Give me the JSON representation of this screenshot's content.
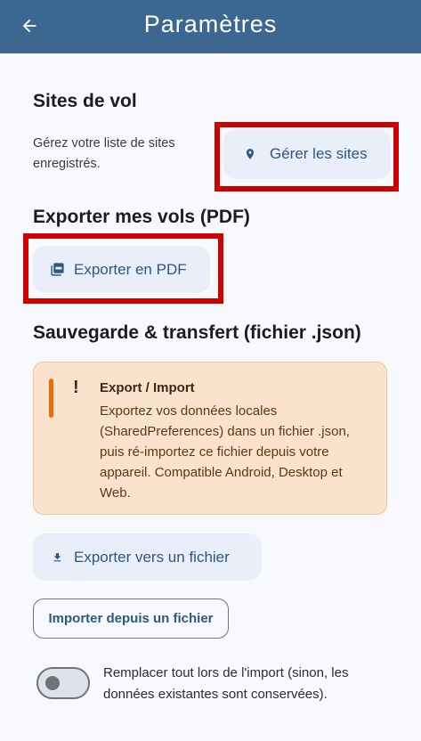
{
  "appbar": {
    "title": "Paramètres",
    "back_icon": "arrow-left-icon",
    "background": "#3c6791"
  },
  "sites": {
    "heading": "Sites de vol",
    "description": "Gérez votre liste de sites enregistrés.",
    "button_label": "Gérer les sites",
    "button_icon": "location-pin-icon"
  },
  "export_pdf": {
    "heading": "Exporter mes vols (PDF)",
    "button_label": "Exporter en PDF",
    "button_icon": "pdf-icon"
  },
  "backup": {
    "heading": "Sauvegarde & transfert (fichier .json)",
    "warning": {
      "title": "Export / Import",
      "text": "Exportez vos données locales (SharedPreferences) dans un fichier .json, puis ré-importez ce fichier depuis votre appareil. Compatible Android, Desktop et Web.",
      "accent": "#f06a0a"
    },
    "export_button_label": "Exporter vers un fichier",
    "export_button_icon": "download-icon",
    "import_button_label": "Importer depuis un fichier",
    "replace_toggle": {
      "label": "Remplacer tout lors de l'import (sinon, les données existantes sont conservées).",
      "checked": false
    }
  },
  "highlight_color": "#d10000"
}
